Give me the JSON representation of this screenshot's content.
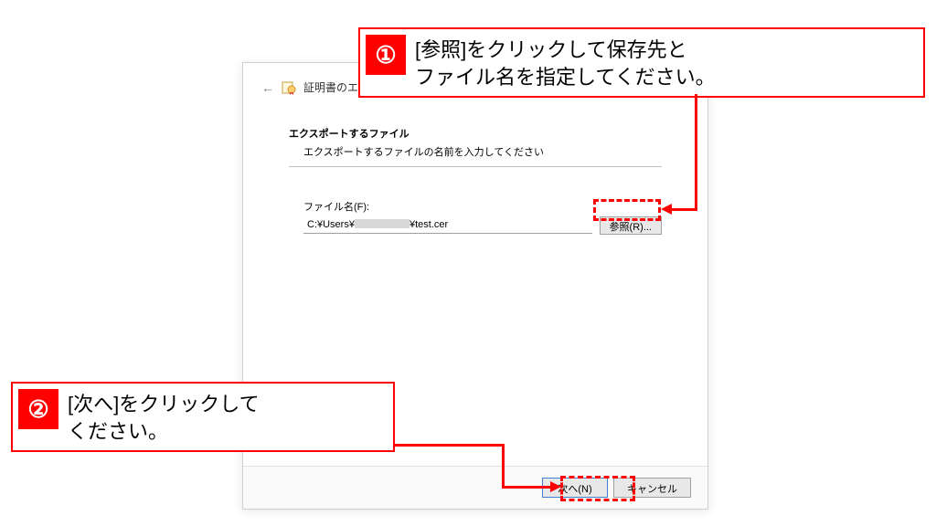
{
  "dialog": {
    "title": "証明書のエクスポー",
    "section_title": "エクスポートするファイル",
    "section_desc": "エクスポートするファイルの名前を入力してください",
    "file_label": "ファイル名(F):",
    "file_value_prefix": "C:¥Users¥",
    "file_value_suffix": "¥test.cer",
    "browse_label": "参照(R)...",
    "next_label": "次へ(N)",
    "cancel_label": "キャンセル"
  },
  "annotations": {
    "callout1": {
      "badge": "①",
      "text": "[参照]をクリックして保存先と\nファイル名を指定してください。"
    },
    "callout2": {
      "badge": "②",
      "text": "[次へ]をクリックして\nください。"
    }
  }
}
